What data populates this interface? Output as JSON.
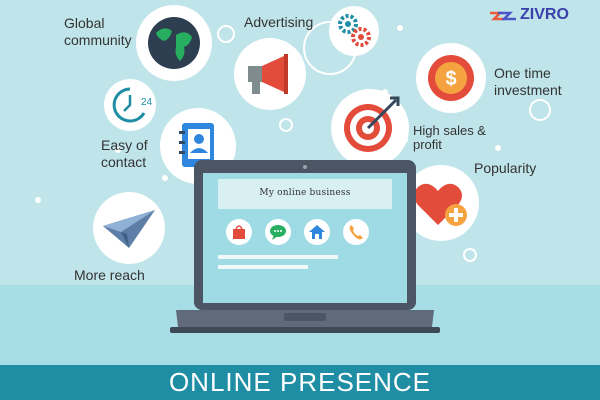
{
  "brand": {
    "name": "ZIVRO"
  },
  "footer": {
    "title": "ONLINE PRESENCE"
  },
  "laptop": {
    "screen_title": "My online business"
  },
  "features": {
    "global_community": {
      "line1": "Global",
      "line2": "community"
    },
    "advertising": {
      "label": "Advertising"
    },
    "one_time_investment": {
      "line1": "One time",
      "line2": "investment"
    },
    "easy_of_contact": {
      "line1": "Easy of",
      "line2": "contact"
    },
    "high_sales_profit": {
      "line1": "High sales &",
      "line2": "profit"
    },
    "popularity": {
      "label": "Popularity"
    },
    "more_reach": {
      "label": "More reach"
    }
  },
  "clock_badge": {
    "value": "24"
  },
  "colors": {
    "accent": "#1f8ea5",
    "background": "#bfe4ea",
    "red": "#e34b3b",
    "orange": "#f4a340"
  },
  "icons": [
    "globe-icon",
    "gears-icon",
    "megaphone-icon",
    "dollar-coin-icon",
    "clock-24-icon",
    "address-book-icon",
    "target-icon",
    "heart-plus-icon",
    "paper-plane-icon",
    "shopping-bag-icon",
    "chat-icon",
    "home-icon",
    "phone-icon"
  ]
}
